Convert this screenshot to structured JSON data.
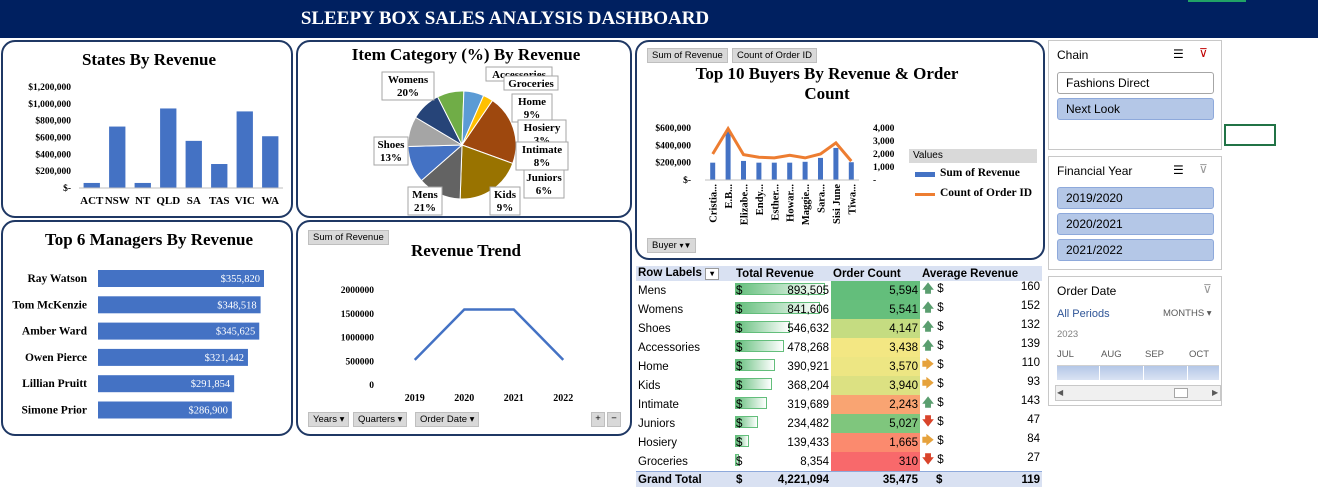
{
  "dashboard": {
    "title": "SLEEPY BOX SALES ANALYSIS DASHBOARD"
  },
  "states_chart": {
    "title": "States By Revenue",
    "chart_data": {
      "type": "bar",
      "title": "States By Revenue",
      "categories": [
        "ACT",
        "NSW",
        "NT",
        "QLD",
        "SA",
        "TAS",
        "VIC",
        "WA"
      ],
      "values": [
        60000,
        730000,
        60000,
        945000,
        560000,
        285000,
        910000,
        615000
      ],
      "ylim": [
        0,
        1200000
      ],
      "yticks": [
        "$1,200,000",
        "$1,000,000",
        "$800,000",
        "$600,000",
        "$400,000",
        "$200,000",
        "$-"
      ],
      "color": "#4472c4"
    }
  },
  "category_chart": {
    "title": "Item Category (%) By Revenue",
    "chart_data": {
      "type": "pie",
      "title": "Item Category (%) By Revenue",
      "labels": [
        "Mens",
        "Womens",
        "Shoes",
        "Accessories",
        "Home",
        "Kids",
        "Intimate",
        "Juniors",
        "Hosiery",
        "Groceries"
      ],
      "values": [
        21,
        20,
        13,
        11,
        9,
        9,
        8,
        6,
        3,
        0
      ],
      "callouts": [
        {
          "name": "Womens",
          "pct": "20%"
        },
        {
          "name": "Accessories",
          "pct": ""
        },
        {
          "name": "Groceries",
          "pct": ""
        },
        {
          "name": "Home",
          "pct": "9%"
        },
        {
          "name": "Hosiery",
          "pct": "3%"
        },
        {
          "name": "Shoes",
          "pct": "13%"
        },
        {
          "name": "Intimate",
          "pct": "8%"
        },
        {
          "name": "Juniors",
          "pct": "6%"
        },
        {
          "name": "Mens",
          "pct": "21%"
        },
        {
          "name": "Kids",
          "pct": "9%"
        }
      ],
      "colors": [
        "#9e480e",
        "#997300",
        "#636363",
        "#4472c4",
        "#a5a5a5",
        "#264478",
        "#70ad47",
        "#5b9bd5",
        "#ffc000",
        "#ed7d31"
      ]
    }
  },
  "buyers_chart": {
    "title_line1": "Top 10 Buyers By Revenue & Order",
    "title_line2": "Count",
    "button_sum_revenue": "Sum of Revenue",
    "button_count_order": "Count of Order ID",
    "buyer_filter": "Buyer",
    "legend_title": "Values",
    "legend": [
      "Sum of Revenue",
      "Count of Order ID"
    ],
    "chart_data": {
      "type": "bar",
      "categories": [
        "Cristia...",
        "E.B...",
        "Elizabe...",
        "Endy...",
        "Esther...",
        "Howar...",
        "Maggie...",
        "Sara...",
        "Sisi June",
        "Tiwa..."
      ],
      "series": [
        {
          "name": "Sum of Revenue",
          "values": [
            200000,
            560000,
            220000,
            200000,
            200000,
            200000,
            210000,
            255000,
            370000,
            205000
          ]
        },
        {
          "name": "Count of Order ID",
          "values": [
            2000,
            3950,
            1950,
            1750,
            1700,
            1900,
            1700,
            2000,
            2850,
            1450
          ]
        }
      ],
      "y_left_ticks": [
        "$600,000",
        "$400,000",
        "$200,000",
        "$-"
      ],
      "y_right_ticks": [
        "4,000",
        "3,000",
        "2,000",
        "1,000",
        "-"
      ],
      "ylim_left": [
        0,
        600000
      ],
      "ylim_right": [
        0,
        4000
      ]
    }
  },
  "managers_chart": {
    "title": "Top 6 Managers By Revenue",
    "chart_data": {
      "type": "bar",
      "categories": [
        "Ray Watson",
        "Tom McKenzie",
        "Amber Ward",
        "Owen Pierce",
        "Lillian Pruitt",
        "Simone Prior"
      ],
      "values": [
        355820,
        348518,
        345625,
        321442,
        291854,
        286900
      ],
      "labels": [
        "$355,820",
        "$348,518",
        "$345,625",
        "$321,442",
        "$291,854",
        "$286,900"
      ]
    }
  },
  "trend_chart": {
    "title": "Revenue Trend",
    "button_sum_revenue": "Sum of Revenue",
    "filters": [
      "Years",
      "Quarters",
      "Order Date"
    ],
    "chart_data": {
      "type": "line",
      "categories": [
        "2019",
        "2020",
        "2021",
        "2022"
      ],
      "values": [
        530000,
        1590000,
        1590000,
        530000
      ],
      "yticks": [
        "2000000",
        "1500000",
        "1000000",
        "500000",
        "0"
      ],
      "ylim": [
        0,
        2000000
      ]
    }
  },
  "pivot": {
    "headers": [
      "Row Labels",
      "Total Revenue",
      "Order Count",
      "Average Revenue"
    ],
    "rows": [
      {
        "label": "Mens",
        "cur": "$",
        "revenue": "893,505",
        "rev_frac": 1.0,
        "count": "5,594",
        "count_color": "#63be7b",
        "arrow": "up",
        "avg_cur": "$",
        "avg": "160"
      },
      {
        "label": "Womens",
        "cur": "$",
        "revenue": "841,606",
        "rev_frac": 0.94,
        "count": "5,541",
        "count_color": "#66bf7c",
        "arrow": "up",
        "avg_cur": "$",
        "avg": "152"
      },
      {
        "label": "Shoes",
        "cur": "$",
        "revenue": "546,632",
        "rev_frac": 0.61,
        "count": "4,147",
        "count_color": "#c5dc81",
        "arrow": "up",
        "avg_cur": "$",
        "avg": "132"
      },
      {
        "label": "Accessories",
        "cur": "$",
        "revenue": "478,268",
        "rev_frac": 0.54,
        "count": "3,438",
        "count_color": "#f3e783",
        "arrow": "up",
        "avg_cur": "$",
        "avg": "139"
      },
      {
        "label": "Home",
        "cur": "$",
        "revenue": "390,921",
        "rev_frac": 0.44,
        "count": "3,570",
        "count_color": "#ede683",
        "arrow": "side",
        "avg_cur": "$",
        "avg": "110"
      },
      {
        "label": "Kids",
        "cur": "$",
        "revenue": "368,204",
        "rev_frac": 0.41,
        "count": "3,940",
        "count_color": "#dce182",
        "arrow": "side",
        "avg_cur": "$",
        "avg": "93"
      },
      {
        "label": "Intimate",
        "cur": "$",
        "revenue": "319,689",
        "rev_frac": 0.36,
        "count": "2,243",
        "count_color": "#f9a472",
        "arrow": "up",
        "avg_cur": "$",
        "avg": "143"
      },
      {
        "label": "Juniors",
        "cur": "$",
        "revenue": "234,482",
        "rev_frac": 0.26,
        "count": "5,027",
        "count_color": "#7fc67d",
        "arrow": "down",
        "avg_cur": "$",
        "avg": "47"
      },
      {
        "label": "Hosiery",
        "cur": "$",
        "revenue": "139,433",
        "rev_frac": 0.16,
        "count": "1,665",
        "count_color": "#fb8a6e",
        "arrow": "side",
        "avg_cur": "$",
        "avg": "84"
      },
      {
        "label": "Groceries",
        "cur": "$",
        "revenue": "8,354",
        "rev_frac": 0.01,
        "count": "310",
        "count_color": "#f8696b",
        "arrow": "down",
        "avg_cur": "$",
        "avg": "27"
      }
    ],
    "total": {
      "label": "Grand Total",
      "cur": "$",
      "revenue": "4,221,094",
      "count": "35,475",
      "avg_cur": "$",
      "avg": "119"
    }
  },
  "slicer_chain": {
    "title": "Chain",
    "items": [
      {
        "label": "Fashions Direct",
        "selected": false
      },
      {
        "label": "Next Look",
        "selected": true
      }
    ]
  },
  "slicer_year": {
    "title": "Financial Year",
    "items": [
      "2019/2020",
      "2020/2021",
      "2021/2022"
    ]
  },
  "timeline": {
    "title": "Order Date",
    "all_periods": "All Periods",
    "level": "MONTHS",
    "year": "2023",
    "months": [
      "JUL",
      "AUG",
      "SEP",
      "OCT"
    ]
  }
}
